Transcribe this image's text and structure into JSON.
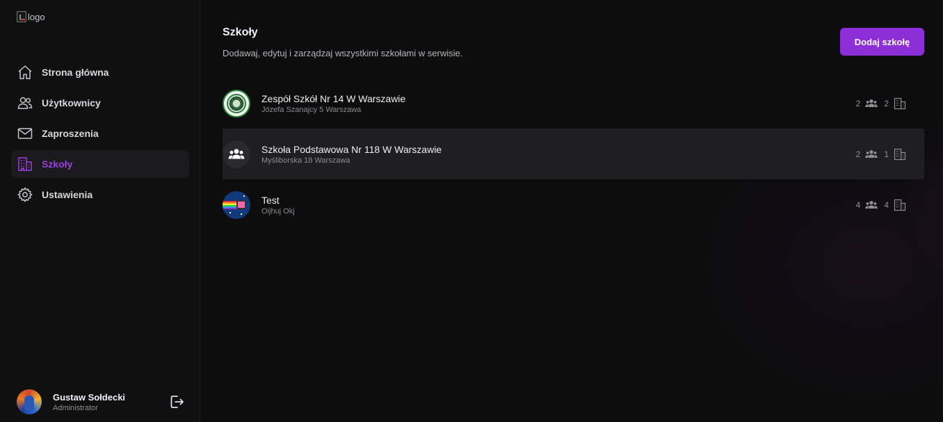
{
  "logo": {
    "alt": "logo"
  },
  "sidebar": {
    "items": [
      {
        "label": "Strona główna",
        "icon": "home-icon",
        "active": false
      },
      {
        "label": "Użytkownicy",
        "icon": "users-icon",
        "active": false
      },
      {
        "label": "Zaproszenia",
        "icon": "mail-icon",
        "active": false
      },
      {
        "label": "Szkoły",
        "icon": "building-icon",
        "active": true
      },
      {
        "label": "Ustawienia",
        "icon": "gear-icon",
        "active": false
      }
    ]
  },
  "user": {
    "name": "Gustaw Sołdecki",
    "role": "Administrator"
  },
  "header": {
    "title": "Szkoły",
    "subtitle": "Dodawaj, edytuj i zarządzaj wszystkimi szkołami w serwisie.",
    "add_button": "Dodaj szkołę"
  },
  "schools": [
    {
      "name": "Zespół Szkół Nr 14 W Warszawie",
      "address": "Józefa Szanajcy 5 Warszawa",
      "users": "2",
      "classes": "2",
      "avatar": "emblem"
    },
    {
      "name": "Szkoła Podstawowa Nr 118 W Warszawie",
      "address": "Myśliborska 18 Warszawa",
      "users": "2",
      "classes": "1",
      "avatar": "group-icon"
    },
    {
      "name": "Test",
      "address": "Oijhuj Okj",
      "users": "4",
      "classes": "4",
      "avatar": "nyan-image"
    }
  ],
  "colors": {
    "accent": "#8c2fd8",
    "active_nav": "#9b3ee0",
    "background": "#0d0d0e",
    "sidebar": "#101011"
  }
}
